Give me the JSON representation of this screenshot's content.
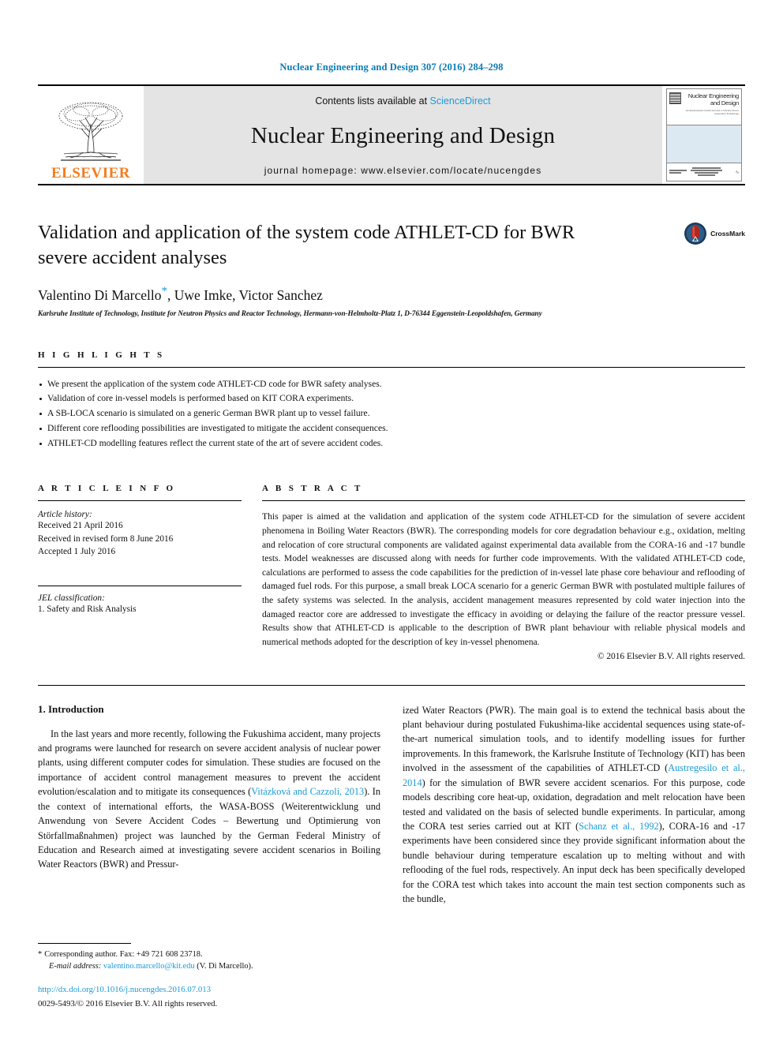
{
  "running_head": "Nuclear Engineering and Design 307 (2016) 284–298",
  "journal_header": {
    "contents_prefix": "Contents lists available at ",
    "sciencedirect": "ScienceDirect",
    "journal_title": "Nuclear Engineering and Design",
    "homepage": "journal homepage: www.elsevier.com/locate/nucengdes",
    "publisher_logo_text": "ELSEVIER",
    "cover": {
      "line1": "Nuclear Engineering",
      "line2": "and Design",
      "subtitle": "An International Journal devoted to Nuclear Power Generation Technology"
    }
  },
  "article": {
    "title": "Validation and application of the system code ATHLET-CD for BWR severe accident analyses",
    "authors": "Valentino Di Marcello",
    "authors_rest": ", Uwe Imke, Victor Sanchez",
    "corresponding_marker": "*",
    "affiliation": "Karlsruhe Institute of Technology, Institute for Neutron Physics and Reactor Technology, Hermann-von-Helmholtz-Platz 1, D-76344 Eggenstein-Leopoldshafen, Germany",
    "crossmark_label": "CrossMark"
  },
  "highlights": {
    "heading": "H I G H L I G H T S",
    "items": [
      "We present the application of the system code ATHLET-CD code for BWR safety analyses.",
      "Validation of core in-vessel models is performed based on KIT CORA experiments.",
      "A SB-LOCA scenario is simulated on a generic German BWR plant up to vessel failure.",
      "Different core reflooding possibilities are investigated to mitigate the accident consequences.",
      "ATHLET-CD modelling features reflect the current state of the art of severe accident codes."
    ]
  },
  "article_info": {
    "heading": "A R T I C L E   I N F O",
    "history_label": "Article history:",
    "history": [
      "Received 21 April 2016",
      "Received in revised form 8 June 2016",
      "Accepted 1 July 2016"
    ],
    "jel_label": "JEL classification:",
    "jel_value": "1. Safety and Risk Analysis"
  },
  "abstract": {
    "heading": "A B S T R A C T",
    "text": "This paper is aimed at the validation and application of the system code ATHLET-CD for the simulation of severe accident phenomena in Boiling Water Reactors (BWR). The corresponding models for core degradation behaviour e.g., oxidation, melting and relocation of core structural components are validated against experimental data available from the CORA-16 and -17 bundle tests. Model weaknesses are discussed along with needs for further code improvements. With the validated ATHLET-CD code, calculations are performed to assess the code capabilities for the prediction of in-vessel late phase core behaviour and reflooding of damaged fuel rods. For this purpose, a small break LOCA scenario for a generic German BWR with postulated multiple failures of the safety systems was selected. In the analysis, accident management measures represented by cold water injection into the damaged reactor core are addressed to investigate the efficacy in avoiding or delaying the failure of the reactor pressure vessel. Results show that ATHLET-CD is applicable to the description of BWR plant behaviour with reliable physical models and numerical methods adopted for the description of key in-vessel phenomena.",
    "copyright": "© 2016 Elsevier B.V. All rights reserved."
  },
  "introduction": {
    "heading": "1. Introduction",
    "left_part1": "In the last years and more recently, following the Fukushima accident, many projects and programs were launched for research on severe accident analysis of nuclear power plants, using different computer codes for simulation. These studies are focused on the importance of accident control management measures to prevent the accident evolution/escalation and to mitigate its consequences (",
    "left_cite1": "Vitázková and Cazzoli, 2013",
    "left_part2": "). In the context of international efforts, the WASA-BOSS (Weiterentwicklung und Anwendung von Severe Accident Codes – Bewertung und Optimierung von Störfallmaßnahmen) project was launched by the German Federal Ministry of Education and Research aimed at investigating severe accident scenarios in Boiling Water Reactors (BWR) and Pressur-",
    "right_part1": "ized Water Reactors (PWR). The main goal is to extend the technical basis about the plant behaviour during postulated Fukushima-like accidental sequences using state-of-the-art numerical simulation tools, and to identify modelling issues for further improvements. In this framework, the Karlsruhe Institute of Technology (KIT) has been involved in the assessment of the capabilities of ATHLET-CD (",
    "right_cite1": "Austregesilo et al., 2014",
    "right_part2": ") for the simulation of BWR severe accident scenarios. For this purpose, code models describing core heat-up, oxidation, degradation and melt relocation have been tested and validated on the basis of selected bundle experiments. In particular, among the CORA test series carried out at KIT (",
    "right_cite2": "Schanz et al., 1992",
    "right_part3": "), CORA-16 and -17 experiments have been considered since they provide significant information about the bundle behaviour during temperature escalation up to melting without and with reflooding of the fuel rods, respectively. An input deck has been specifically developed for the CORA test which takes into account the main test section components such as the bundle,"
  },
  "footnote": {
    "corresponding": "Corresponding author. Fax: +49 721 608 23718.",
    "star": "*",
    "email_label": "E-mail address:",
    "email": "valentino.marcello@kit.edu",
    "email_suffix": "(V. Di Marcello).",
    "doi": "http://dx.doi.org/10.1016/j.nucengdes.2016.07.013",
    "issn": "0029-5493/© 2016 Elsevier B.V. All rights reserved."
  },
  "colors": {
    "link_blue": "#1a9ad7",
    "running_head_blue": "#0b7bb5",
    "elsevier_orange": "#F47C20",
    "header_band": "#e4e4e4",
    "cover_blue": "#dce9f2"
  }
}
